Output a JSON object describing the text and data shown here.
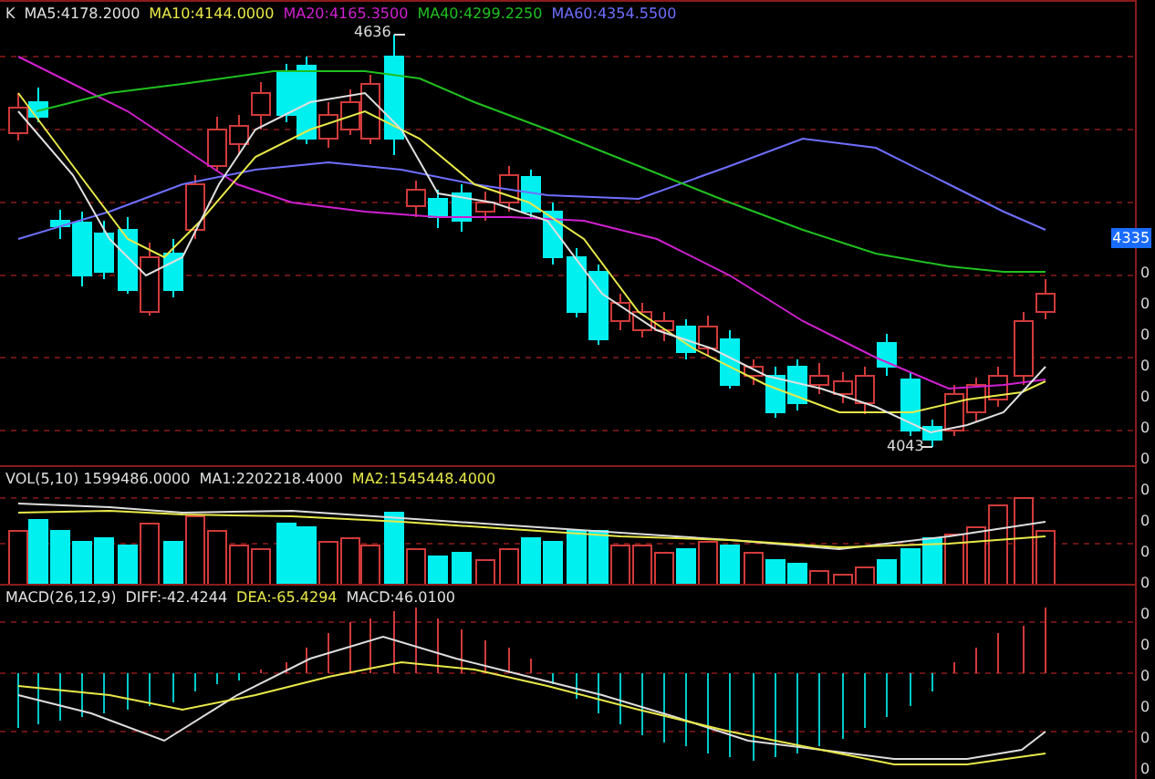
{
  "main_panel": {
    "prefix": "K",
    "legend": [
      {
        "label": "MA5:4178.2000",
        "color": "#e0e0e0"
      },
      {
        "label": "MA10:4144.0000",
        "color": "#e8e84a"
      },
      {
        "label": "MA20:4165.3500",
        "color": "#d020d0"
      },
      {
        "label": "MA40:4299.2250",
        "color": "#20c020"
      },
      {
        "label": "MA60:4354.5500",
        "color": "#6f6fff"
      }
    ],
    "high_label": "4636",
    "low_label": "4043",
    "price_tag": "4335"
  },
  "volume_panel": {
    "legend": [
      {
        "label": "VOL(5,10) 1599486.0000",
        "color": "#e0e0e0"
      },
      {
        "label": "MA1:2202218.4000",
        "color": "#e0e0e0"
      },
      {
        "label": "MA2:1545448.4000",
        "color": "#e8e84a"
      }
    ]
  },
  "macd_panel": {
    "legend": [
      {
        "label": "MACD(26,12,9)",
        "color": "#e0e0e0"
      },
      {
        "label": "DIFF:-42.4244",
        "color": "#e0e0e0"
      },
      {
        "label": "DEA:-65.4294",
        "color": "#e8e84a"
      },
      {
        "label": "MACD:46.0100",
        "color": "#e0e0e0"
      }
    ]
  },
  "side_values": [
    "0",
    "0",
    "0",
    "0",
    "0",
    "0",
    "0",
    "0",
    "0",
    "0",
    "0",
    "0",
    "0",
    "0",
    "0",
    "0",
    "0"
  ]
}
